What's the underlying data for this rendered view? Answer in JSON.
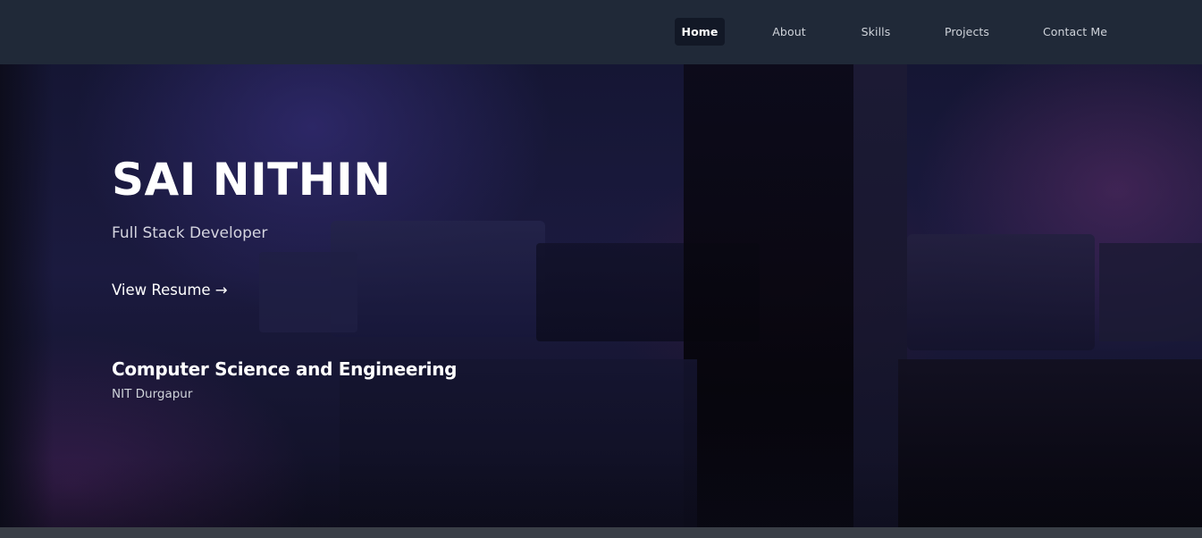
{
  "nav": {
    "items": [
      {
        "label": "Home",
        "active": true
      },
      {
        "label": "About",
        "active": false
      },
      {
        "label": "Skills",
        "active": false
      },
      {
        "label": "Projects",
        "active": false
      },
      {
        "label": "Contact Me",
        "active": false
      }
    ]
  },
  "hero": {
    "name": "SAI NITHIN",
    "role": "Full Stack Developer",
    "resume_link": "View Resume →",
    "degree": "Computer Science and Engineering",
    "college": "NIT Durgapur"
  },
  "colors": {
    "navbar_bg": "#202938",
    "nav_active_bg": "#121826",
    "hero_bg": "#1b1a3f",
    "text_primary": "#ffffff",
    "text_secondary": "#cfd3da"
  }
}
